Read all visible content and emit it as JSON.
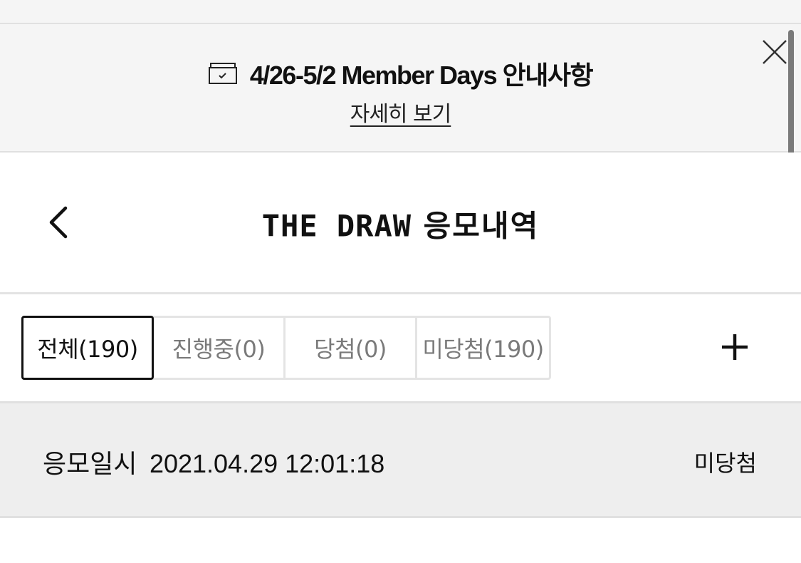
{
  "banner": {
    "icon": "calendar-box-icon",
    "title": "4/26-5/2 Member Days 안내사항",
    "link_label": "자세히 보기",
    "close_icon": "close-icon"
  },
  "header": {
    "back_icon": "chevron-left-icon",
    "title_en": "THE DRAW",
    "title_ko": "응모내역"
  },
  "tabs": [
    {
      "label": "전체(190)",
      "active": true
    },
    {
      "label": "진행중(0)",
      "active": false
    },
    {
      "label": "당첨(0)",
      "active": false
    },
    {
      "label": "미당첨(190)",
      "active": false
    }
  ],
  "filter_icon": "plus-icon",
  "entries": [
    {
      "label": "응모일시",
      "datetime": "2021.04.29 12:01:18",
      "status": "미당첨"
    }
  ],
  "colors": {
    "banner_bg": "#f5f5f5",
    "entry_bg": "#eeeeee",
    "text": "#111111",
    "muted": "#7a7a7a"
  }
}
